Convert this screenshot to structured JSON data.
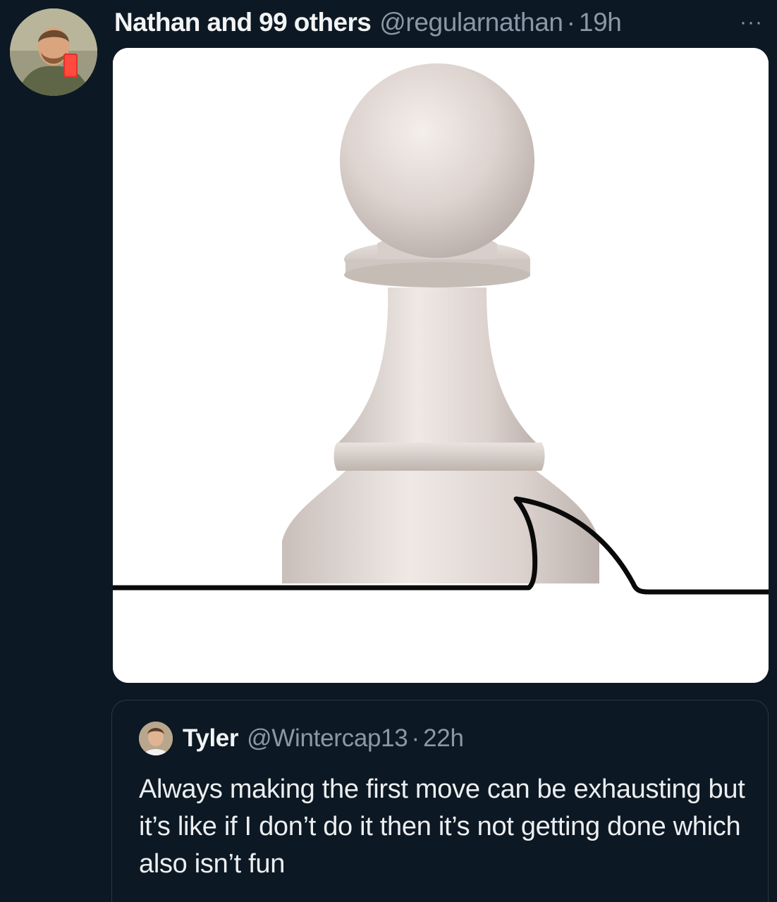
{
  "tweet": {
    "author_name": "Nathan and 99 others",
    "handle": "@regularnathan",
    "separator": "·",
    "time": "19h",
    "more_label": "···",
    "avatar_icon": "profile-photo",
    "media_description_icon": "chess-pawn-image"
  },
  "quoted_tweet": {
    "author_name": "Tyler",
    "handle": "@Wintercap13",
    "separator": "·",
    "time": "22h",
    "text": "Always making the first move can be exhausting but it’s like if I don’t do it then it’s not getting done which also isn’t fun"
  },
  "colors": {
    "background": "#0c1823",
    "secondary_text": "#8b98a5",
    "primary_text": "#e7e9ea"
  }
}
